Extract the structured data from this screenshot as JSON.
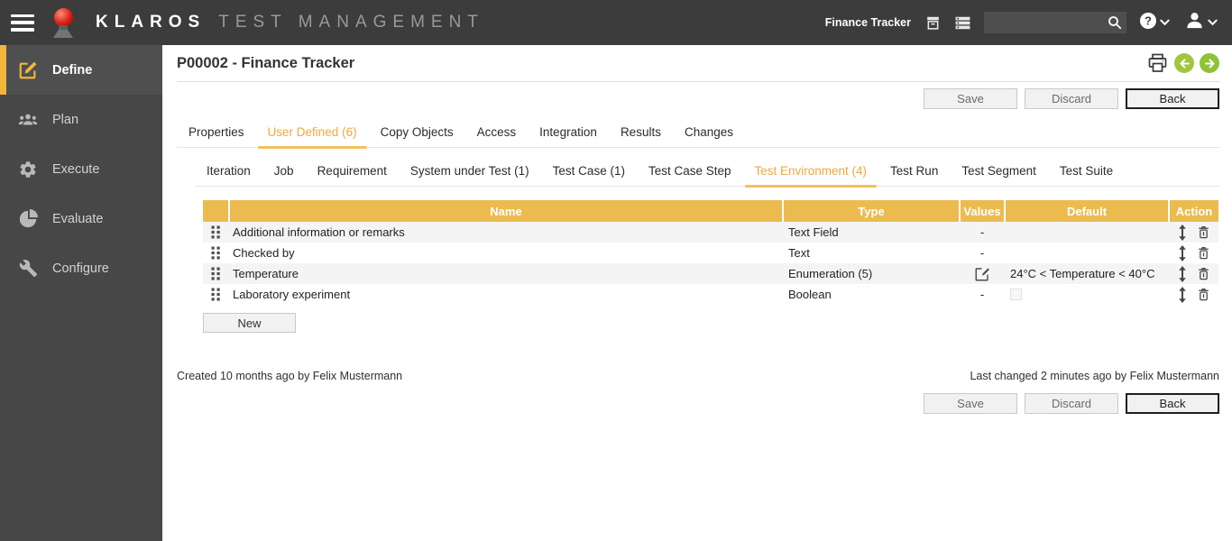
{
  "topbar": {
    "brand": "KLAROS",
    "product": "TEST MANAGEMENT",
    "project": "Finance Tracker",
    "search_value": ""
  },
  "sidebar": {
    "items": [
      {
        "label": "Define"
      },
      {
        "label": "Plan"
      },
      {
        "label": "Execute"
      },
      {
        "label": "Evaluate"
      },
      {
        "label": "Configure"
      }
    ]
  },
  "page": {
    "title": "P00002 - Finance Tracker",
    "save_label": "Save",
    "discard_label": "Discard",
    "back_label": "Back",
    "new_label": "New",
    "created_text": "Created 10 months ago by Felix Mustermann",
    "changed_text": "Last changed 2 minutes ago by Felix Mustermann"
  },
  "tabs": [
    "Properties",
    "User Defined (6)",
    "Copy Objects",
    "Access",
    "Integration",
    "Results",
    "Changes"
  ],
  "active_tab": "User Defined (6)",
  "subtabs": [
    "Iteration",
    "Job",
    "Requirement",
    "System under Test (1)",
    "Test Case (1)",
    "Test Case Step",
    "Test Environment (4)",
    "Test Run",
    "Test Segment",
    "Test Suite"
  ],
  "active_subtab": "Test Environment (4)",
  "table": {
    "headers": [
      "Name",
      "Type",
      "Values",
      "Default",
      "Action"
    ],
    "rows": [
      {
        "name": "Additional information or remarks",
        "type": "Text Field",
        "values": "-",
        "default": ""
      },
      {
        "name": "Checked by",
        "type": "Text",
        "values": "-",
        "default": ""
      },
      {
        "name": "Temperature",
        "type": "Enumeration (5)",
        "values": "",
        "default": "24°C < Temperature < 40°C"
      },
      {
        "name": "Laboratory experiment",
        "type": "Boolean",
        "values": "-",
        "default": ""
      }
    ],
    "row4_checkbox_checked": false
  },
  "icons": {
    "hamburger": "three-bars",
    "archive": "box-with-lid",
    "storage": "stacked-bars",
    "search": "magnifier",
    "help": "?",
    "user": "person-silhouette",
    "chevron": "v",
    "print": "printer-outline",
    "nav_prev": "left-arrow-green-circle",
    "nav_next": "right-arrow-green-circle",
    "drag": "six-dots",
    "edit_values": "square-pencil",
    "reorder": "up-down-arrow",
    "delete": "trash-can"
  },
  "colors": {
    "accent_orange": "#ECBB50",
    "tab_active": "#EDA93F",
    "topbar_bg": "#3C3C3C",
    "sidebar_bg": "#474747",
    "sidebar_active_bar": "#F2B63C",
    "nav_green": "#8FC235",
    "row_alt": "#F4F4F4"
  }
}
